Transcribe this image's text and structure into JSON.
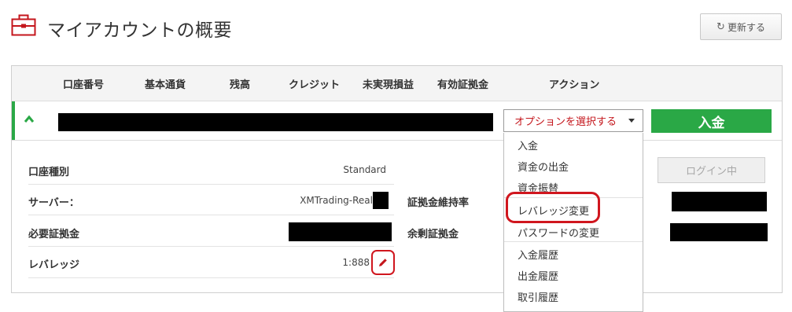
{
  "header": {
    "title": "マイアカウントの概要",
    "refresh_label": "更新する"
  },
  "table": {
    "columns": [
      "口座番号",
      "基本通貨",
      "残高",
      "クレジット",
      "未実現損益",
      "有効証拠金",
      "アクション"
    ]
  },
  "account": {
    "select_label": "オプションを選択する",
    "deposit_label": "入金",
    "login_label": "ログイン中"
  },
  "details": {
    "account_type_label": "口座種別",
    "account_type_value": "Standard",
    "server_label": "サーバー：",
    "server_value": "XMTrading-Real",
    "required_margin_label": "必要証拠金",
    "leverage_label": "レバレッジ",
    "leverage_value": "1:888",
    "margin_level_label": "証拠金維持率",
    "free_margin_label": "余剰証拠金"
  },
  "menu": {
    "items": [
      "入金",
      "資金の出金",
      "資金振替",
      "レバレッジ変更",
      "パスワードの変更",
      "入金履歴",
      "出金履歴",
      "取引履歴"
    ]
  },
  "colors": {
    "brand_red": "#c4161c",
    "green": "#2aa846",
    "highlight_red": "#d0161e"
  },
  "icons": {
    "page": "briefcase-icon",
    "refresh": "refresh-icon",
    "expand": "chevron-up-icon",
    "dropdown": "caret-down-icon",
    "edit": "pencil-icon"
  }
}
